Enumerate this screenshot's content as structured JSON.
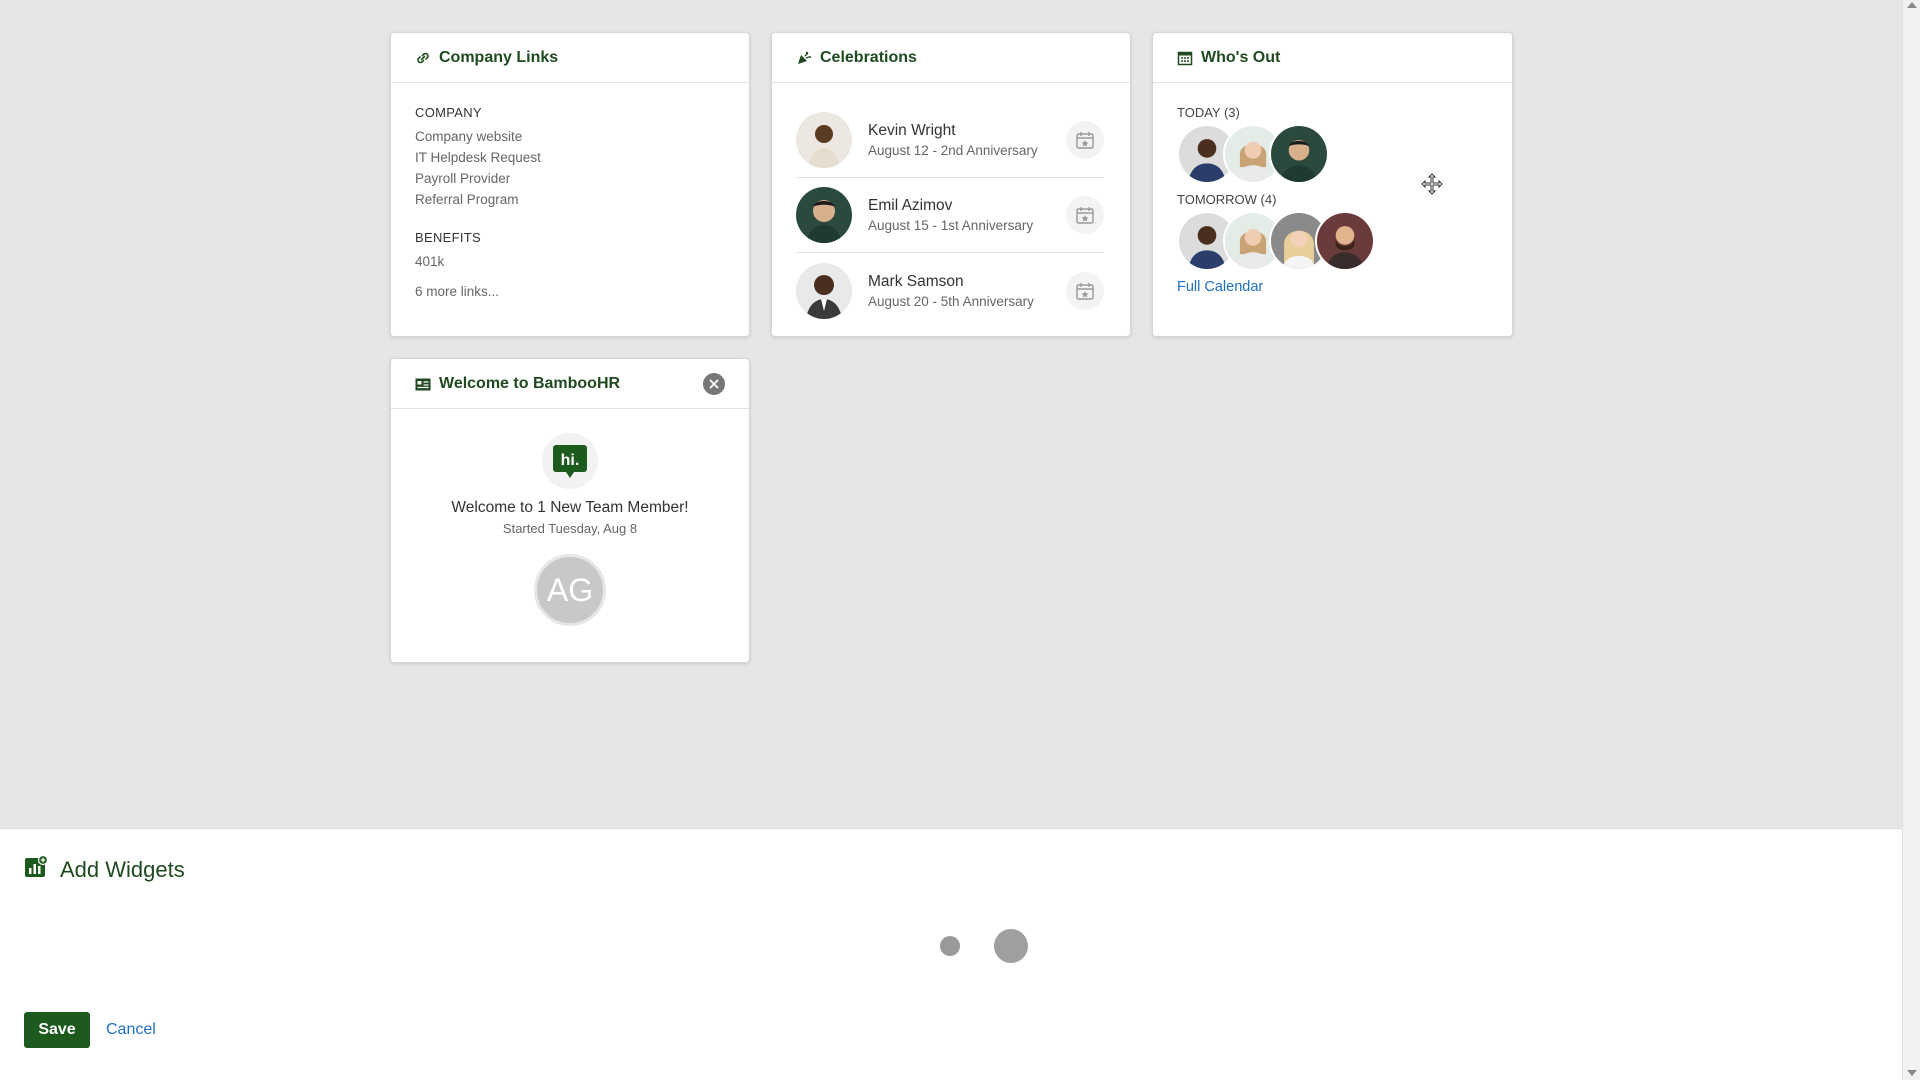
{
  "company_links": {
    "title": "Company Links",
    "sections": [
      {
        "label": "COMPANY",
        "links": [
          "Company website",
          "IT Helpdesk Request",
          "Payroll Provider",
          "Referral Program"
        ]
      },
      {
        "label": "BENEFITS",
        "links": [
          "401k"
        ]
      }
    ],
    "more": "6 more links..."
  },
  "celebrations": {
    "title": "Celebrations",
    "items": [
      {
        "name": "Kevin Wright",
        "detail": "August 12 - 2nd Anniversary"
      },
      {
        "name": "Emil Azimov",
        "detail": "August 15 - 1st Anniversary"
      },
      {
        "name": "Mark Samson",
        "detail": "August 20 - 5th Anniversary"
      }
    ]
  },
  "whos_out": {
    "title": "Who's Out",
    "today_label": "TODAY (3)",
    "tomorrow_label": "TOMORROW (4)",
    "full_calendar": "Full Calendar"
  },
  "welcome": {
    "title": "Welcome to BambooHR",
    "hi": "hi.",
    "heading": "Welcome to 1 New Team Member!",
    "started": "Started Tuesday, Aug 8",
    "initials": "AG"
  },
  "add_widgets": {
    "title": "Add Widgets",
    "save": "Save",
    "cancel": "Cancel"
  },
  "colors": {
    "brand_green": "#1d5a1d",
    "link_blue": "#1f6fbf"
  }
}
